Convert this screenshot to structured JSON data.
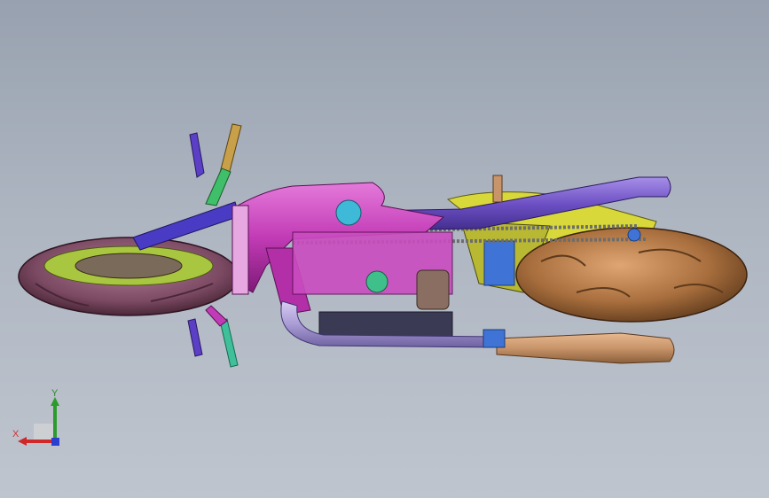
{
  "viewport": {
    "background_top": "#98a1af",
    "background_bottom": "#bfc5ce"
  },
  "model": {
    "description_icon": "motorcycle-assembly-3d-model",
    "colors": {
      "frame": "#c23bb6",
      "frame_dark": "#8d1f86",
      "fuel_tank": "#d350c9",
      "exhaust_pipe": "#a99bd4",
      "front_pipe": "#6b4fc3",
      "muffler": "#c8946a",
      "front_tire": "#7c4a63",
      "rear_tire": "#a86e3d",
      "front_rim": "#a8c640",
      "chain": "#6d6d6d",
      "fork": "#4a3bc4",
      "grip_left": "#c9a04a",
      "grip_right": "#3fbf9a",
      "engine": "#3a3a55",
      "swingarm": "#d8d83a",
      "blue_bracket": "#3f74d6",
      "mirror_stalk": "#5b3fc7"
    }
  },
  "triad": {
    "x_label": "X",
    "y_label": "Y",
    "x_color": "#d02828",
    "y_color": "#2d9a2d",
    "z_color": "#2a3fd0"
  }
}
